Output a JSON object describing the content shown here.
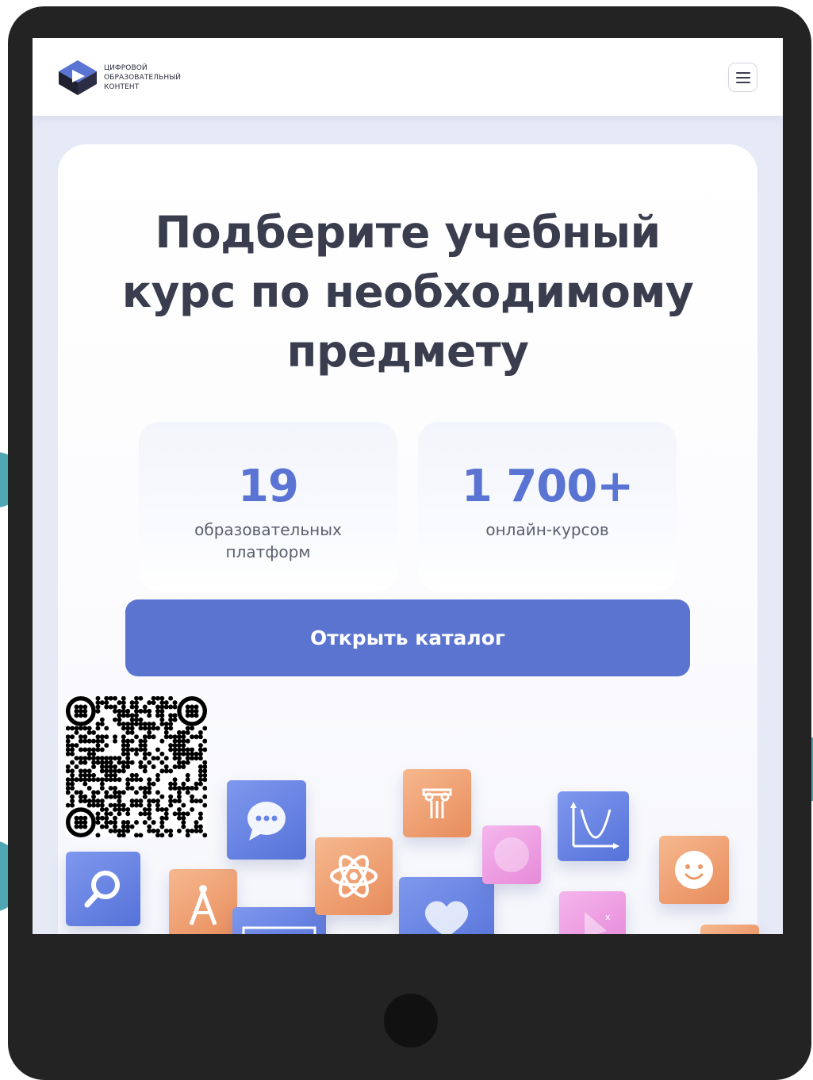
{
  "header": {
    "logo_lines": [
      "Цифровой",
      "образовательный",
      "контент"
    ],
    "logo_colors": {
      "primary": "#5a74d3",
      "dark": "#1f2130"
    },
    "menu_icon": "hamburger-icon"
  },
  "hero": {
    "title_lines": [
      "Подберите учебный",
      "курс по необходимому",
      "предмету"
    ]
  },
  "stats": [
    {
      "value": "19",
      "label_lines": [
        "образовательных",
        "платформ"
      ]
    },
    {
      "value": "1 700+",
      "label_lines": [
        "онлайн-курсов"
      ]
    }
  ],
  "catalog_button": {
    "label": "Открыть каталог"
  },
  "subject_icons": [
    "search-icon",
    "compass-icon",
    "chat-bubble-icon",
    "geometry-frame-icon",
    "atom-icon",
    "ancient-columns-icon",
    "heart-icon",
    "pink-circle-icon",
    "graph-icon",
    "triangle-icon",
    "smiley-icon",
    "orange-tile-icon"
  ],
  "colors": {
    "accent": "#5a74cf",
    "title_text": "#3a3d4e",
    "stat_value": "#5a74d3",
    "tile_blue": "#5572d8",
    "tile_orange": "#e88c5c",
    "tile_pink": "#e78ad9"
  }
}
